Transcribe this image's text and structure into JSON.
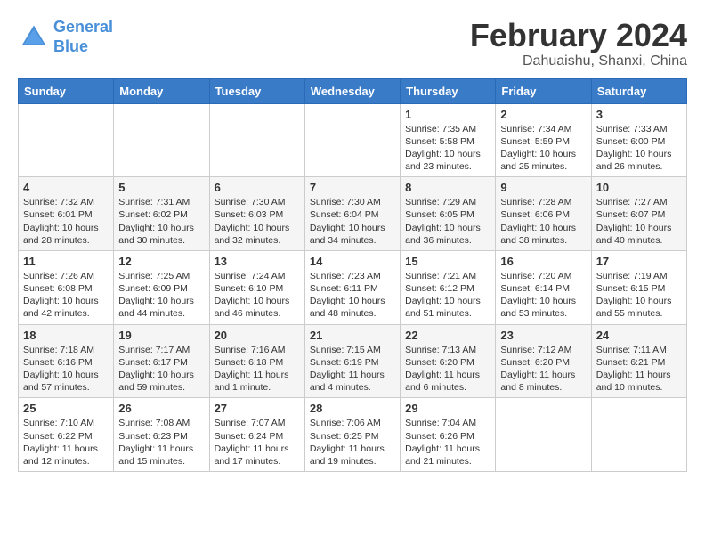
{
  "logo": {
    "line1": "General",
    "line2": "Blue"
  },
  "title": "February 2024",
  "subtitle": "Dahuaishu, Shanxi, China",
  "days_of_week": [
    "Sunday",
    "Monday",
    "Tuesday",
    "Wednesday",
    "Thursday",
    "Friday",
    "Saturday"
  ],
  "weeks": [
    [
      {
        "day": "",
        "info": ""
      },
      {
        "day": "",
        "info": ""
      },
      {
        "day": "",
        "info": ""
      },
      {
        "day": "",
        "info": ""
      },
      {
        "day": "1",
        "info": "Sunrise: 7:35 AM\nSunset: 5:58 PM\nDaylight: 10 hours\nand 23 minutes."
      },
      {
        "day": "2",
        "info": "Sunrise: 7:34 AM\nSunset: 5:59 PM\nDaylight: 10 hours\nand 25 minutes."
      },
      {
        "day": "3",
        "info": "Sunrise: 7:33 AM\nSunset: 6:00 PM\nDaylight: 10 hours\nand 26 minutes."
      }
    ],
    [
      {
        "day": "4",
        "info": "Sunrise: 7:32 AM\nSunset: 6:01 PM\nDaylight: 10 hours\nand 28 minutes."
      },
      {
        "day": "5",
        "info": "Sunrise: 7:31 AM\nSunset: 6:02 PM\nDaylight: 10 hours\nand 30 minutes."
      },
      {
        "day": "6",
        "info": "Sunrise: 7:30 AM\nSunset: 6:03 PM\nDaylight: 10 hours\nand 32 minutes."
      },
      {
        "day": "7",
        "info": "Sunrise: 7:30 AM\nSunset: 6:04 PM\nDaylight: 10 hours\nand 34 minutes."
      },
      {
        "day": "8",
        "info": "Sunrise: 7:29 AM\nSunset: 6:05 PM\nDaylight: 10 hours\nand 36 minutes."
      },
      {
        "day": "9",
        "info": "Sunrise: 7:28 AM\nSunset: 6:06 PM\nDaylight: 10 hours\nand 38 minutes."
      },
      {
        "day": "10",
        "info": "Sunrise: 7:27 AM\nSunset: 6:07 PM\nDaylight: 10 hours\nand 40 minutes."
      }
    ],
    [
      {
        "day": "11",
        "info": "Sunrise: 7:26 AM\nSunset: 6:08 PM\nDaylight: 10 hours\nand 42 minutes."
      },
      {
        "day": "12",
        "info": "Sunrise: 7:25 AM\nSunset: 6:09 PM\nDaylight: 10 hours\nand 44 minutes."
      },
      {
        "day": "13",
        "info": "Sunrise: 7:24 AM\nSunset: 6:10 PM\nDaylight: 10 hours\nand 46 minutes."
      },
      {
        "day": "14",
        "info": "Sunrise: 7:23 AM\nSunset: 6:11 PM\nDaylight: 10 hours\nand 48 minutes."
      },
      {
        "day": "15",
        "info": "Sunrise: 7:21 AM\nSunset: 6:12 PM\nDaylight: 10 hours\nand 51 minutes."
      },
      {
        "day": "16",
        "info": "Sunrise: 7:20 AM\nSunset: 6:14 PM\nDaylight: 10 hours\nand 53 minutes."
      },
      {
        "day": "17",
        "info": "Sunrise: 7:19 AM\nSunset: 6:15 PM\nDaylight: 10 hours\nand 55 minutes."
      }
    ],
    [
      {
        "day": "18",
        "info": "Sunrise: 7:18 AM\nSunset: 6:16 PM\nDaylight: 10 hours\nand 57 minutes."
      },
      {
        "day": "19",
        "info": "Sunrise: 7:17 AM\nSunset: 6:17 PM\nDaylight: 10 hours\nand 59 minutes."
      },
      {
        "day": "20",
        "info": "Sunrise: 7:16 AM\nSunset: 6:18 PM\nDaylight: 11 hours\nand 1 minute."
      },
      {
        "day": "21",
        "info": "Sunrise: 7:15 AM\nSunset: 6:19 PM\nDaylight: 11 hours\nand 4 minutes."
      },
      {
        "day": "22",
        "info": "Sunrise: 7:13 AM\nSunset: 6:20 PM\nDaylight: 11 hours\nand 6 minutes."
      },
      {
        "day": "23",
        "info": "Sunrise: 7:12 AM\nSunset: 6:20 PM\nDaylight: 11 hours\nand 8 minutes."
      },
      {
        "day": "24",
        "info": "Sunrise: 7:11 AM\nSunset: 6:21 PM\nDaylight: 11 hours\nand 10 minutes."
      }
    ],
    [
      {
        "day": "25",
        "info": "Sunrise: 7:10 AM\nSunset: 6:22 PM\nDaylight: 11 hours\nand 12 minutes."
      },
      {
        "day": "26",
        "info": "Sunrise: 7:08 AM\nSunset: 6:23 PM\nDaylight: 11 hours\nand 15 minutes."
      },
      {
        "day": "27",
        "info": "Sunrise: 7:07 AM\nSunset: 6:24 PM\nDaylight: 11 hours\nand 17 minutes."
      },
      {
        "day": "28",
        "info": "Sunrise: 7:06 AM\nSunset: 6:25 PM\nDaylight: 11 hours\nand 19 minutes."
      },
      {
        "day": "29",
        "info": "Sunrise: 7:04 AM\nSunset: 6:26 PM\nDaylight: 11 hours\nand 21 minutes."
      },
      {
        "day": "",
        "info": ""
      },
      {
        "day": "",
        "info": ""
      }
    ]
  ]
}
